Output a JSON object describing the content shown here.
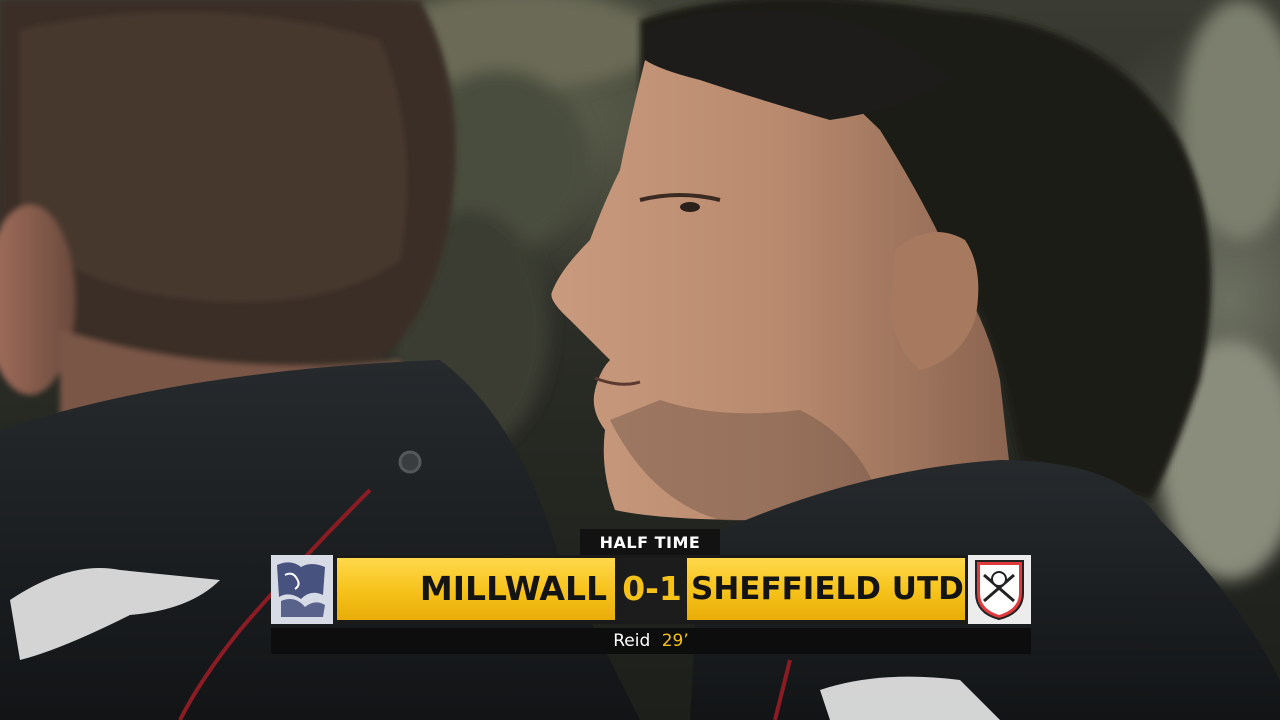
{
  "scorebug": {
    "status": "HALF TIME",
    "home_team": "MILLWALL",
    "score": "0-1",
    "away_team": "SHEFFIELD UTD",
    "goal_scorer": "Reid",
    "goal_minute": "29’",
    "colors": {
      "accent": "#f6c21a",
      "dark": "#1a1a1a"
    }
  },
  "icons": {
    "home_crest": "millwall-lion-crest-icon",
    "away_crest": "sheffield-united-blades-crest-icon"
  }
}
